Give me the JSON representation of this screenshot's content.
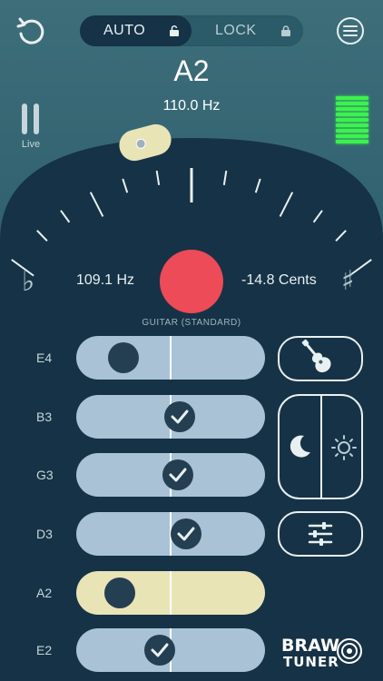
{
  "header": {
    "mode_auto_label": "AUTO",
    "mode_lock_label": "LOCK"
  },
  "note": {
    "name": "A2",
    "target_frequency": "110.0 Hz"
  },
  "live_label": "Live",
  "level_meter": {
    "bars_lit": 9,
    "color": "#3cf24e"
  },
  "readout": {
    "detected_frequency": "109.1 Hz",
    "cents": "-14.8 Cents",
    "flat_symbol": "♭",
    "sharp_symbol": "♯",
    "indicator_color": "#ec4b57"
  },
  "tuning_name": "GUITAR (STANDARD)",
  "strings": [
    {
      "label": "E4",
      "state": "untuned",
      "position": 0.25
    },
    {
      "label": "B3",
      "state": "tuned",
      "position": 0.55
    },
    {
      "label": "G3",
      "state": "tuned",
      "position": 0.54
    },
    {
      "label": "D3",
      "state": "tuned",
      "position": 0.58
    },
    {
      "label": "A2",
      "state": "active",
      "position": 0.23
    },
    {
      "label": "E2",
      "state": "tuned",
      "position": 0.44
    }
  ],
  "icons": {
    "undo": "undo-icon",
    "menu": "menu-icon",
    "pause": "pause-icon",
    "instrument": "guitar-icon",
    "night": "moon-icon",
    "day": "sun-icon",
    "settings": "sliders-icon"
  },
  "brand": {
    "line1": "BRAW",
    "line2": "TUNER"
  },
  "colors": {
    "background": "#2f5f6d",
    "dial": "#163246",
    "string_bar": "#a9c2d6",
    "string_active": "#e8e4b6"
  }
}
